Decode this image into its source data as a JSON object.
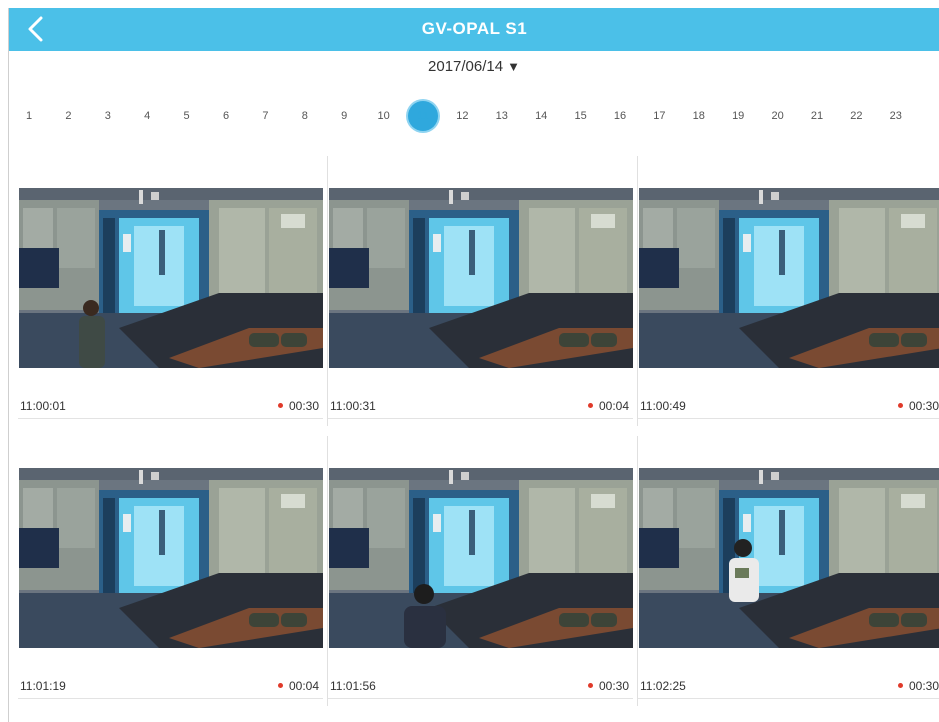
{
  "header": {
    "title": "GV-OPAL S1",
    "back_icon": "chevron-left-icon",
    "background": "#4bc0e8"
  },
  "date_selector": {
    "date": "2017/06/14",
    "caret": "▼"
  },
  "hours": [
    "1",
    "2",
    "3",
    "4",
    "5",
    "6",
    "7",
    "8",
    "9",
    "10",
    "11",
    "12",
    "13",
    "14",
    "15",
    "16",
    "17",
    "18",
    "19",
    "20",
    "21",
    "22",
    "23"
  ],
  "selected_hour": "11",
  "selected_color": "#2fa8dd",
  "clips": [
    {
      "time": "11:00:01",
      "duration": "00:30",
      "person": "left"
    },
    {
      "time": "11:00:31",
      "duration": "00:04",
      "person": "none"
    },
    {
      "time": "11:00:49",
      "duration": "00:30",
      "person": "none"
    },
    {
      "time": "11:01:19",
      "duration": "00:04",
      "person": "none"
    },
    {
      "time": "11:01:56",
      "duration": "00:30",
      "person": "center"
    },
    {
      "time": "11:02:25",
      "duration": "00:30",
      "person": "right"
    }
  ],
  "recording_dot_color": "#e03a2a"
}
